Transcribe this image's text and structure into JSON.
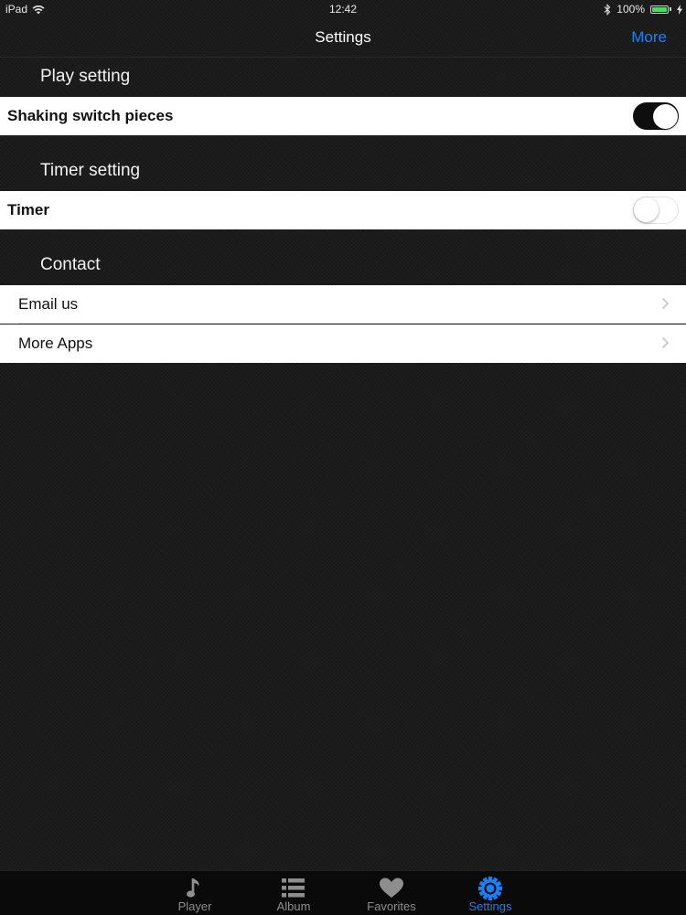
{
  "status_bar": {
    "device": "iPad",
    "time": "12:42",
    "battery_text": "100%",
    "battery_level": 1.0
  },
  "nav": {
    "title": "Settings",
    "more_label": "More"
  },
  "sections": {
    "play": {
      "header": "Play setting",
      "row_label": "Shaking switch pieces",
      "toggle_on": true
    },
    "timer": {
      "header": "Timer setting",
      "row_label": "Timer",
      "toggle_on": false
    },
    "contact": {
      "header": "Contact",
      "items": [
        {
          "label": "Email us"
        },
        {
          "label": "More Apps"
        }
      ]
    }
  },
  "tabs": [
    {
      "label": "Player",
      "icon": "music-note-icon",
      "active": false
    },
    {
      "label": "Album",
      "icon": "list-icon",
      "active": false
    },
    {
      "label": "Favorites",
      "icon": "heart-icon",
      "active": false
    },
    {
      "label": "Settings",
      "icon": "gear-icon",
      "active": true
    }
  ],
  "colors": {
    "accent": "#1d7ff5",
    "background": "#1c1b1c",
    "tab_inactive": "#8e8e8e",
    "toggle_on": "#0e0e0e",
    "battery": "#4cd964"
  }
}
